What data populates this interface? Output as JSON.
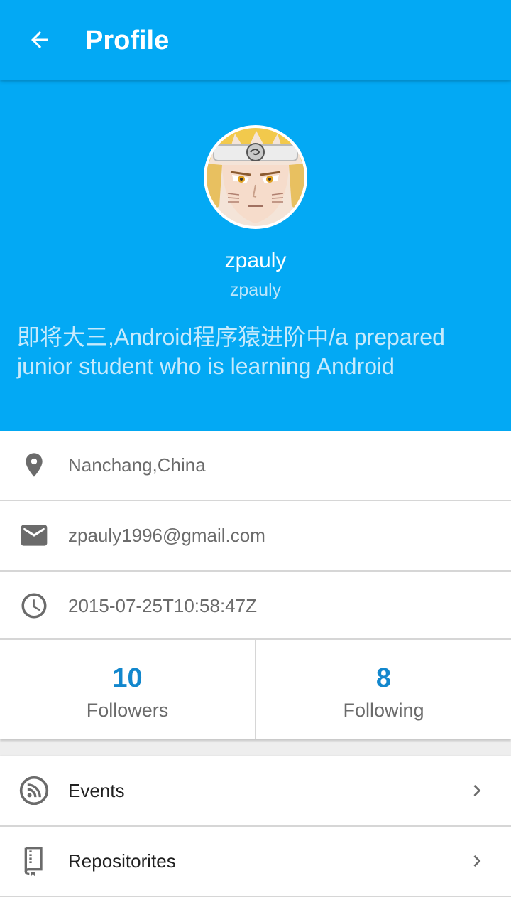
{
  "appbar": {
    "title": "Profile",
    "back_icon": "arrow-back-icon"
  },
  "profile": {
    "display_name": "zpauly",
    "login": "zpauly",
    "bio": "即将大三,Android程序猿进阶中/a prepared junior student who is learning Android",
    "avatar_icon": "avatar-image"
  },
  "details": [
    {
      "icon": "location-pin-icon",
      "text": "Nanchang,China"
    },
    {
      "icon": "email-icon",
      "text": "zpauly1996@gmail.com"
    },
    {
      "icon": "clock-icon",
      "text": "2015-07-25T10:58:47Z"
    }
  ],
  "stats": {
    "followers": {
      "count": "10",
      "label": "Followers"
    },
    "following": {
      "count": "8",
      "label": "Following"
    }
  },
  "nav": [
    {
      "icon": "rss-feed-icon",
      "label": "Events"
    },
    {
      "icon": "book-icon",
      "label": "Repositorites"
    }
  ],
  "colors": {
    "primary": "#03a9f4",
    "accent_number": "#1287cd",
    "secondary_text": "#6b6b6b",
    "background": "#eeeeee"
  }
}
